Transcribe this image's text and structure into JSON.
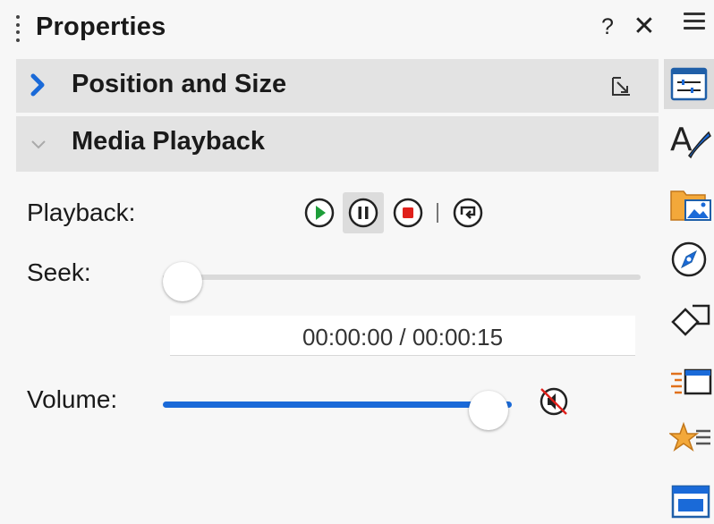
{
  "panel": {
    "title": "Properties",
    "help_label": "?",
    "close_label": "✕"
  },
  "sections": {
    "position_size": {
      "label": "Position and Size",
      "expanded": false
    },
    "media_playback": {
      "label": "Media Playback",
      "expanded": true
    }
  },
  "media": {
    "playback_label": "Playback:",
    "seek_label": "Seek:",
    "volume_label": "Volume:",
    "time_display": "00:00:00 / 00:00:15",
    "seek_position": 0.0,
    "volume_level": 0.98,
    "buttons": [
      "play",
      "pause",
      "stop",
      "loop"
    ],
    "active_button": "pause",
    "muted": false
  },
  "sidebar_tabs": [
    "properties-icon",
    "styles-icon",
    "gallery-icon",
    "navigator-icon",
    "shapes-icon",
    "slide-transition-icon",
    "animation-icon",
    "master-slides-icon"
  ],
  "colors": {
    "accent": "#1a6ad8",
    "play_green": "#1e9e3a",
    "stop_red": "#e0201b",
    "section_bg": "#e3e3e3"
  }
}
